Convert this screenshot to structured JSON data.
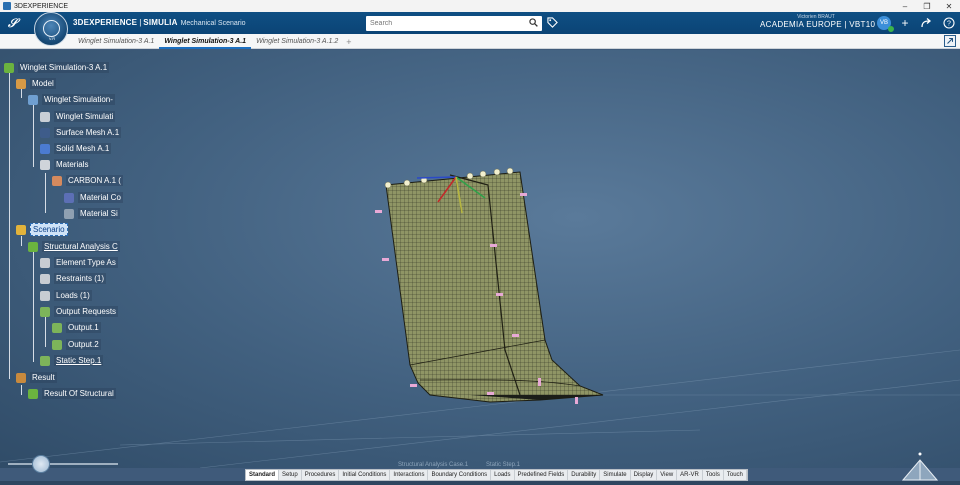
{
  "os": {
    "title": "3DEXPERIENCE",
    "controls": [
      "–",
      "❐",
      "✕"
    ]
  },
  "header": {
    "brand_3d": "3DEXPERIENCE",
    "brand_sep": "|",
    "brand_simulia": "SIMULIA",
    "app_name": "Mechanical Scenario",
    "compass_version": "V.R",
    "search_placeholder": "Search",
    "user_name": "Victorien BRAUT",
    "tenant": "ACADEMIA EUROPE | VBT10 ▾",
    "avatar_initials": "VB"
  },
  "tabs": [
    {
      "label": "Winglet Simulation-3 A.1"
    },
    {
      "label": "Winglet Simulation-3 A.1",
      "active": true
    },
    {
      "label": "Winglet Simulation-3 A.1.2"
    }
  ],
  "tab_add": "+",
  "tree": {
    "root": "Winglet Simulation-3 A.1",
    "model": "Model",
    "model_child": "Winglet Simulation-",
    "winglet_sim": "Winglet Simulati",
    "surface_mesh": "Surface Mesh A.1",
    "solid_mesh": "Solid Mesh A.1",
    "materials": "Materials",
    "carbon": "CARBON A.1 (",
    "material_co": "Material Co",
    "material_si": "Material Si",
    "scenario": "Scenario",
    "structural": "Structural Analysis C",
    "element_type": "Element Type As",
    "restraints": "Restraints (1)",
    "loads": "Loads (1)",
    "output_requests": "Output Requests",
    "output1": "Output.1",
    "output2": "Output.2",
    "static_step": "Static Step.1",
    "result": "Result",
    "result_of": "Result Of Structural"
  },
  "ghost": {
    "case": "Structural Analysis Case.1",
    "step": "Static Step.1"
  },
  "slider": {
    "value": 0.3
  },
  "action_bar": [
    "Standard",
    "Setup",
    "Procedures",
    "Initial Conditions",
    "Interactions",
    "Boundary Conditions",
    "Loads",
    "Predefined Fields",
    "Durability",
    "Simulate",
    "Display",
    "View",
    "AR-VR",
    "Tools",
    "Touch"
  ],
  "colors": {
    "header_blue": "#0b4476",
    "accent": "#1c6fc0",
    "mesh_fill": "#8f9565"
  }
}
